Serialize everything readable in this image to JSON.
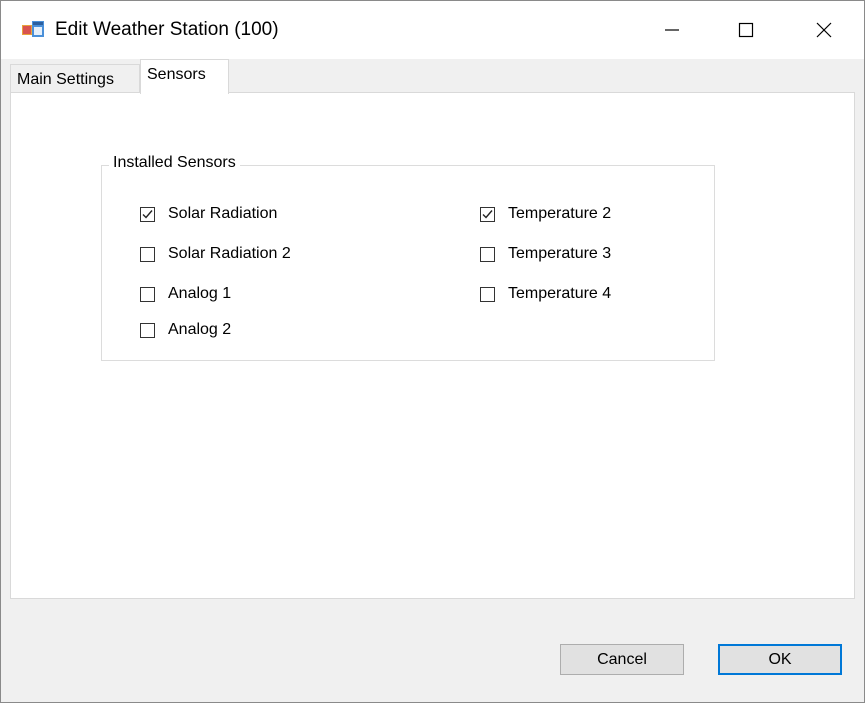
{
  "window": {
    "title": "Edit Weather Station (100)",
    "app_icon": "app-window-icon",
    "controls": {
      "minimize": "minimize-icon",
      "maximize": "maximize-icon",
      "close": "close-icon"
    }
  },
  "tabs": [
    {
      "label": "Main Settings",
      "active": false
    },
    {
      "label": "Sensors",
      "active": true
    }
  ],
  "sensors": {
    "group_title": "Installed Sensors",
    "items": [
      {
        "label": "Solar Radiation",
        "checked": true
      },
      {
        "label": "Solar Radiation 2",
        "checked": false
      },
      {
        "label": "Analog 1",
        "checked": false
      },
      {
        "label": "Analog 2",
        "checked": false
      },
      {
        "label": "Temperature 2",
        "checked": true
      },
      {
        "label": "Temperature 3",
        "checked": false
      },
      {
        "label": "Temperature 4",
        "checked": false
      }
    ]
  },
  "buttons": {
    "cancel": "Cancel",
    "ok": "OK"
  },
  "colors": {
    "accent": "#0078d7",
    "button_face": "#e1e1e1",
    "dialog_bg": "#f0f0f0"
  }
}
